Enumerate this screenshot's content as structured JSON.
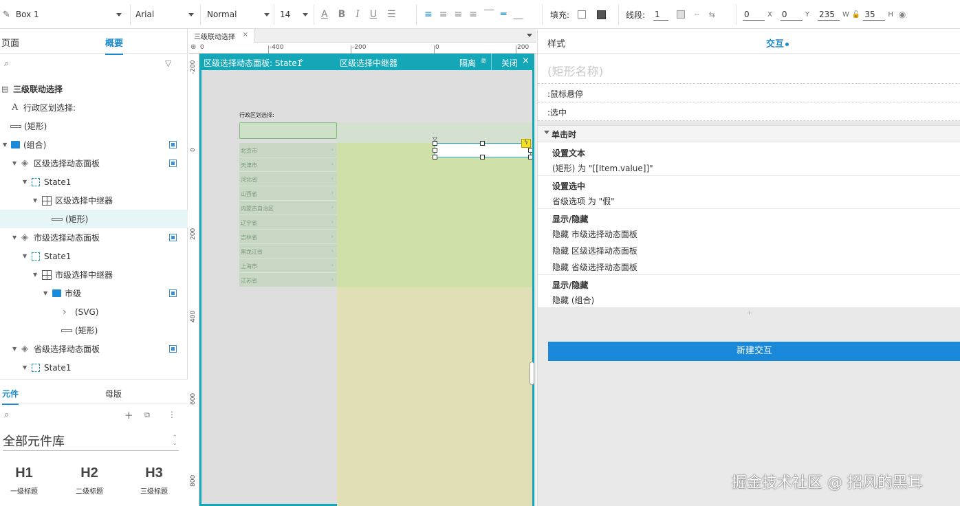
{
  "toolbar": {
    "style_name": "Box 1",
    "font_family": "Arial",
    "font_weight": "Normal",
    "font_size": "14",
    "fill_label": "填充:",
    "line_label": "线段:",
    "line_value": "1",
    "x_value": "0",
    "x_label": "X",
    "y_value": "0",
    "y_label": "Y",
    "w_value": "235",
    "w_label": "W",
    "h_value": "35",
    "h_label": "H"
  },
  "left": {
    "tabs": {
      "pages": "页面",
      "outline": "概要"
    },
    "tree": [
      {
        "label": "三级联动选择",
        "bold": true
      },
      {
        "label": "行政区划选择:"
      },
      {
        "label": "(矩形)"
      },
      {
        "label": "(组合)"
      },
      {
        "label": "区级选择动态面板"
      },
      {
        "label": "State1"
      },
      {
        "label": "区级选择中继器"
      },
      {
        "label": "(矩形)"
      },
      {
        "label": "市级选择动态面板"
      },
      {
        "label": "State1"
      },
      {
        "label": "市级选择中继器"
      },
      {
        "label": "市级"
      },
      {
        "label": "(SVG)"
      },
      {
        "label": "(矩形)"
      },
      {
        "label": "省级选择动态面板"
      },
      {
        "label": "State1"
      }
    ],
    "bottom_tabs": {
      "widgets": "元件",
      "masters": "母版"
    },
    "library": "全部元件库",
    "widgets": [
      {
        "big": "H1",
        "small": "一级标题"
      },
      {
        "big": "H2",
        "small": "二级标题"
      },
      {
        "big": "H3",
        "small": "三级标题"
      }
    ]
  },
  "canvas": {
    "doc_tab": "三级联动选择",
    "frame_path": "区级选择动态面板: State1",
    "frame_title": "区级选择中继器",
    "isolate_label": "隔离",
    "close_label": "关闭",
    "ruler_h": [
      "0",
      "-400",
      "-200",
      "0",
      "200"
    ],
    "ruler_v": [
      "-200",
      "0",
      "200",
      "400",
      "600",
      "800"
    ],
    "label_text": "行政区划选择:",
    "provinces": [
      "北京市",
      "天津市",
      "河北省",
      "山西省",
      "内蒙古自治区",
      "辽宁省",
      "吉林省",
      "黑龙江省",
      "上海市",
      "江苏省"
    ]
  },
  "right": {
    "tabs": {
      "style": "样式",
      "interactions": "交互"
    },
    "name_placeholder": "(矩形名称)",
    "states": [
      ":鼠标悬停",
      ":选中"
    ],
    "event": "单击时",
    "actions": [
      {
        "title": "设置文本",
        "lines": [
          "(矩形) 为 \"[[Item.value]]\""
        ]
      },
      {
        "title": "设置选中",
        "lines": [
          "省级选项 为 \"假\""
        ]
      },
      {
        "title": "显示/隐藏",
        "lines": [
          "隐藏 市级选择动态面板",
          "隐藏 区级选择动态面板",
          "隐藏 省级选择动态面板"
        ]
      },
      {
        "title": "显示/隐藏",
        "lines": [
          "隐藏 (组合)"
        ]
      }
    ],
    "add_symbol": "+",
    "new_interaction": "新建交互"
  },
  "watermark": "掘金技术社区 @ 招风的黑耳",
  "colors": {
    "accent": "#1a89c9",
    "frame": "#13a7b8",
    "button": "#1a89d9"
  }
}
